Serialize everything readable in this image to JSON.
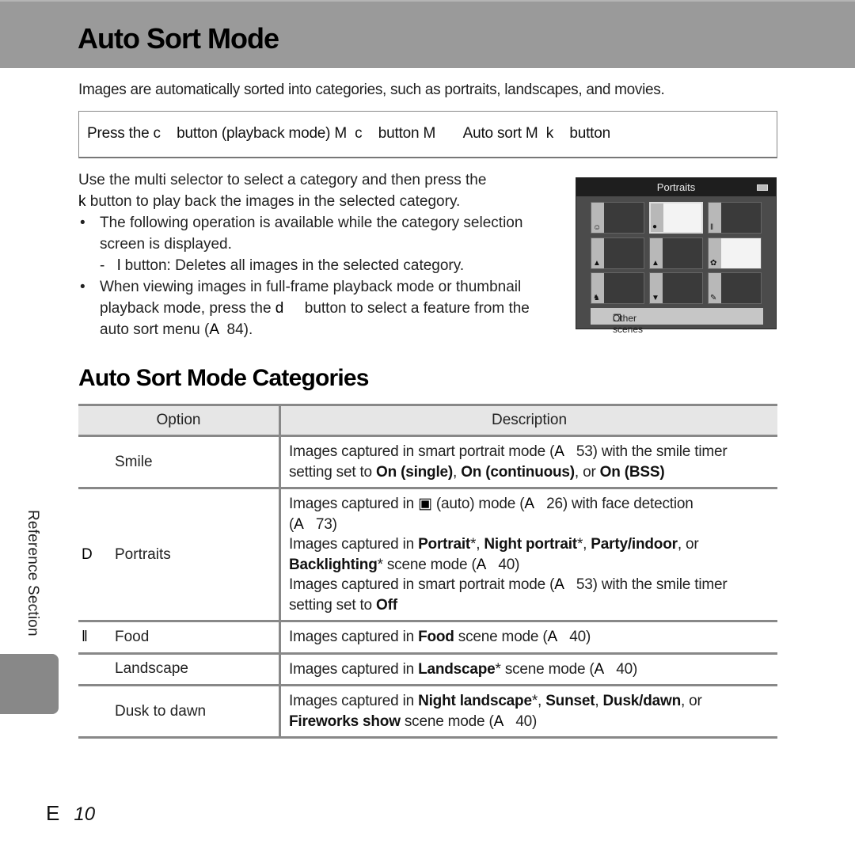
{
  "header": {
    "title": "Auto Sort Mode"
  },
  "intro": "Images are automatically sorted into categories, such as portraits, landscapes, and movies.",
  "navigation_path": "Press the c    button (playback mode) M  c    button M       Auto sort M  k    button",
  "body": {
    "line1": "Use the multi selector to select a category and then press the",
    "line2_glyph": "k",
    "line2": " button to play back the images in the selected category.",
    "bullet1": "The following operation is available while the category selection screen is displayed.",
    "sub1_glyph": "l",
    "sub1": " button: Deletes all images in the selected category.",
    "bullet2_a": "When viewing images in full-frame playback mode or thumbnail playback mode, press the ",
    "bullet2_glyph": "d",
    "bullet2_b": "     button to select a feature from the auto sort menu (",
    "bullet2_ref_glyph": "A",
    "bullet2_ref": "  84)."
  },
  "camera_screen": {
    "title": "Portraits",
    "battery_icon": "battery-icon",
    "grid": [
      {
        "icon": "smile-icon",
        "glyph": "☺",
        "selected": false,
        "has_image": false
      },
      {
        "icon": "portrait-icon",
        "glyph": "●",
        "selected": true,
        "has_image": true
      },
      {
        "icon": "food-icon",
        "glyph": "ǁ",
        "selected": false,
        "has_image": false
      },
      {
        "icon": "landscape-icon",
        "glyph": "▲",
        "selected": false,
        "has_image": false
      },
      {
        "icon": "dusk-icon",
        "glyph": "▲",
        "selected": false,
        "has_image": false
      },
      {
        "icon": "closeup-icon",
        "glyph": "✿",
        "selected": false,
        "has_image": true
      },
      {
        "icon": "pet-icon",
        "glyph": "♞",
        "selected": false,
        "has_image": false
      },
      {
        "icon": "movie-icon",
        "glyph": "▼",
        "selected": false,
        "has_image": false
      },
      {
        "icon": "retouch-icon",
        "glyph": "✎",
        "selected": false,
        "has_image": false
      }
    ],
    "other_scenes_label": "Other scenes",
    "other_scenes_glyph": "❐"
  },
  "section_title": "Auto Sort Mode Categories",
  "table": {
    "headers": [
      "Option",
      "Description"
    ],
    "rows": [
      {
        "icon_glyph": "",
        "option": "Smile",
        "desc_html": "Images captured in smart portrait mode (<span class=\"glyph\">A</span>&nbsp;&nbsp; 53) with the smile timer setting set to <b>On (single)</b>, <b>On (continuous)</b>, or <b>On (BSS)</b>"
      },
      {
        "icon_glyph": "D",
        "option": "Portraits",
        "desc_html": "Images captured in <span class=\"glyph\">&#9635;</span> (auto) mode (<span class=\"glyph\">A</span>&nbsp;&nbsp; 26) with face detection<br>(<span class=\"glyph\">A</span>&nbsp;&nbsp; 73)<br>Images captured in <b>Portrait</b>*, <b>Night portrait</b>*, <b>Party/indoor</b>, or <b>Backlighting</b>* scene mode (<span class=\"glyph\">A</span>&nbsp;&nbsp; 40)<br>Images captured in smart portrait mode (<span class=\"glyph\">A</span>&nbsp;&nbsp; 53) with the smile timer setting set to <b>Off</b>"
      },
      {
        "icon_glyph": "ǁ",
        "option": "Food",
        "desc_html": "Images captured in <b>Food</b> scene mode (<span class=\"glyph\">A</span>&nbsp;&nbsp; 40)"
      },
      {
        "icon_glyph": "",
        "option": "Landscape",
        "desc_html": "Images captured in <b>Landscape</b>* scene mode (<span class=\"glyph\">A</span>&nbsp;&nbsp; 40)"
      },
      {
        "icon_glyph": "",
        "option": "Dusk to dawn",
        "desc_html": "Images captured in <b>Night landscape</b>*, <b>Sunset</b>, <b>Dusk/dawn</b>, or <b>Fireworks show</b> scene mode (<span class=\"glyph\">A</span>&nbsp;&nbsp; 40)"
      }
    ]
  },
  "side_label": "Reference Section",
  "footer": {
    "glyph": "E",
    "page_number": "10"
  }
}
